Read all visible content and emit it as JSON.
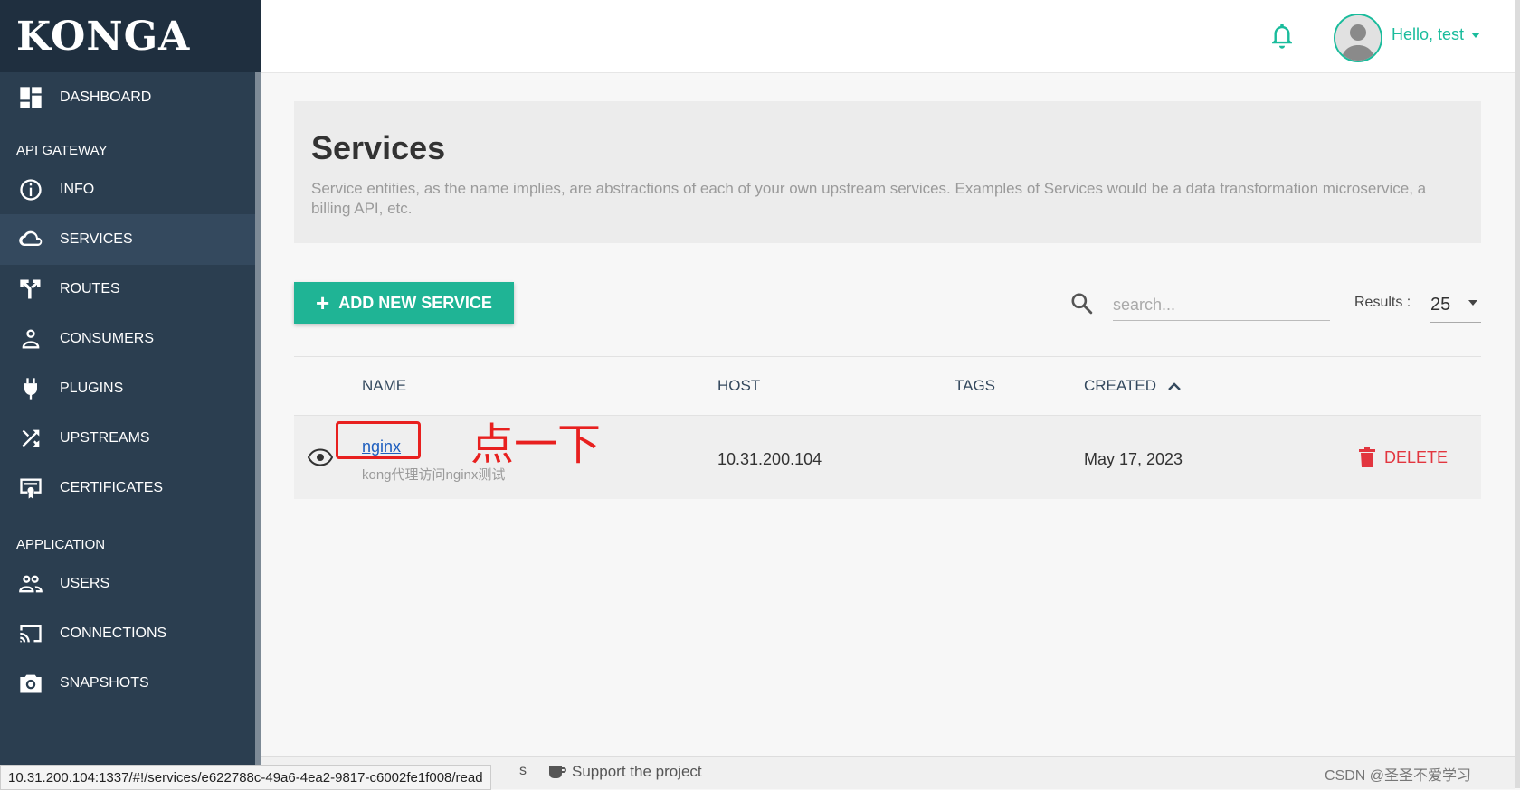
{
  "app": {
    "logo": "KONGA"
  },
  "sidebar": {
    "dashboard": "DASHBOARD",
    "section_gateway": "API GATEWAY",
    "gateway_items": [
      "INFO",
      "SERVICES",
      "ROUTES",
      "CONSUMERS",
      "PLUGINS",
      "UPSTREAMS",
      "CERTIFICATES"
    ],
    "section_application": "APPLICATION",
    "app_items": [
      "USERS",
      "CONNECTIONS",
      "SNAPSHOTS"
    ],
    "active": "SERVICES"
  },
  "topbar": {
    "user_greeting": "Hello, test"
  },
  "header": {
    "title": "Services",
    "description": "Service entities, as the name implies, are abstractions of each of your own upstream services. Examples of Services would be a data transformation microservice, a billing API, etc."
  },
  "toolbar": {
    "add_label": "ADD NEW SERVICE",
    "search_placeholder": "search...",
    "results_label": "Results :",
    "results_value": "25"
  },
  "table": {
    "columns": [
      "NAME",
      "HOST",
      "TAGS",
      "CREATED"
    ],
    "rows": [
      {
        "name": "nginx",
        "description": "kong代理访问nginx测试",
        "host": "10.31.200.104",
        "tags": "",
        "created": "May 17, 2023",
        "action": "DELETE"
      }
    ]
  },
  "annotation": {
    "text": "点一下"
  },
  "footer": {
    "fragment": "s",
    "support": "Support the project",
    "watermark": "CSDN @圣圣不爱学习"
  },
  "status_url": "10.31.200.104:1337/#!/services/e622788c-49a6-4ea2-9817-c6002fe1f008/read",
  "colors": {
    "sidebar": "#2b3e50",
    "accent": "#1abc9c",
    "danger": "#e2363f",
    "annotation": "#e8201f"
  }
}
